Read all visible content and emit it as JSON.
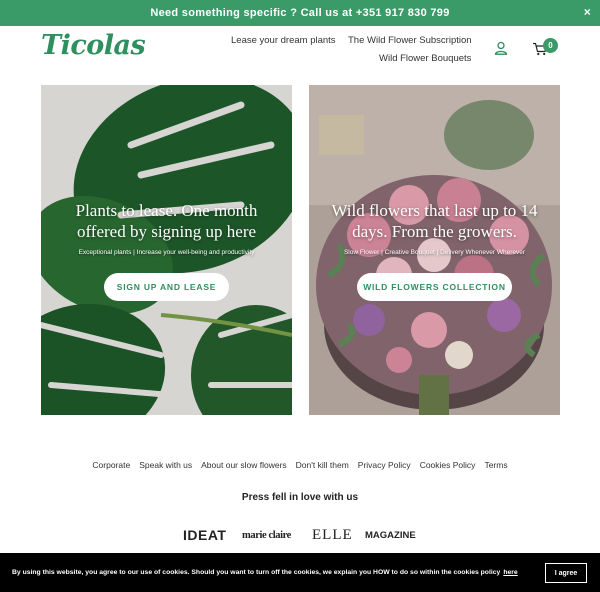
{
  "topbar": {
    "message": "Need something specific ? Call us at +351 917 830 799",
    "close_glyph": "×"
  },
  "header": {
    "logo": "Ticolas",
    "nav": [
      {
        "label": "Lease your dream plants"
      },
      {
        "label": "The Wild Flower Subscription"
      },
      {
        "label": "Wild Flower Bouquets"
      }
    ],
    "account_icon": "user-icon",
    "cart_icon": "cart-icon",
    "cart_count": "0"
  },
  "hero": [
    {
      "title": "Plants to lease. One month offered by signing up here",
      "subtitle": "Exceptional plants | Increase your well-being and productivity",
      "button": "SIGN UP AND LEASE"
    },
    {
      "title": "Wild flowers that last up to 14 days. From the growers.",
      "subtitle": "Slow Flower | Creative Bouquet | Delivery Whenever Wherever",
      "button": "WILD FLOWERS COLLECTION"
    }
  ],
  "footer": {
    "links": [
      "Corporate",
      "Speak with us",
      "About our slow flowers",
      "Don't kill them",
      "Privacy Policy",
      "Cookies Policy",
      "Terms"
    ],
    "press_heading": "Press fell in love with us",
    "press_logos": [
      "IDEAT",
      "marie claire",
      "ELLE",
      "MAGAZINE"
    ]
  },
  "cookie": {
    "text": "By using this website, you agree to our use of cookies. Should you want to turn off the cookies, we explain you HOW to do so within the cookies policy",
    "link": "here",
    "agree": "I agree"
  },
  "colors": {
    "brand_green": "#3a9a68",
    "logo_green": "#2f8f5f",
    "cookie_bar": "#000000"
  }
}
